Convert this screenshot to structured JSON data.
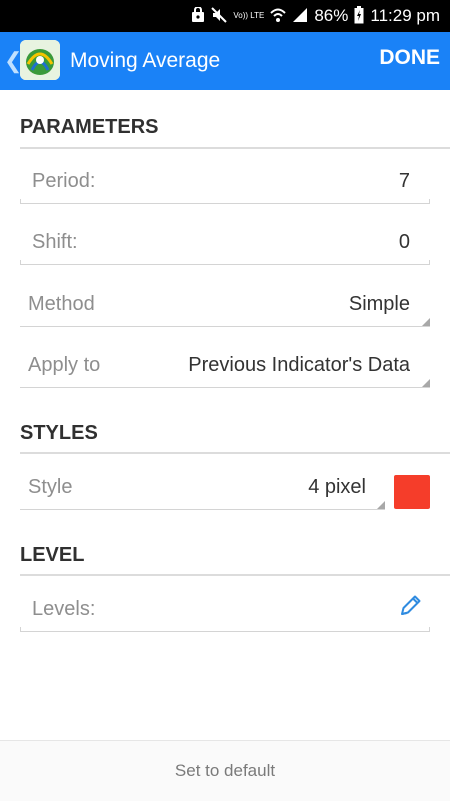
{
  "status_bar": {
    "battery": "86%",
    "time": "11:29 pm",
    "volte": "Vo)) LTE",
    "icons": [
      "lock-icon",
      "mute-icon",
      "volte-icon",
      "wifi-icon",
      "signal-icon",
      "battery-icon"
    ]
  },
  "header": {
    "title": "Moving Average",
    "done_label": "DONE",
    "back_icon": "chevron-left-icon",
    "logo_icon": "metatrader-logo-icon"
  },
  "sections": {
    "parameters": "PARAMETERS",
    "styles": "STYLES",
    "level": "LEVEL"
  },
  "fields": {
    "period": {
      "label": "Period:",
      "value": "7"
    },
    "shift": {
      "label": "Shift:",
      "value": "0"
    },
    "method": {
      "label": "Method",
      "value": "Simple"
    },
    "apply_to": {
      "label": "Apply to",
      "value": "Previous Indicator's Data"
    },
    "style": {
      "label": "Style",
      "value": "4 pixel",
      "color": "#f53d2a"
    },
    "levels": {
      "label": "Levels:",
      "edit_icon": "pencil-icon"
    }
  },
  "footer": {
    "default_label": "Set to default"
  },
  "colors": {
    "app_bar": "#1a82f7",
    "style_color": "#f53d2a",
    "edit_icon": "#2f8be0"
  }
}
